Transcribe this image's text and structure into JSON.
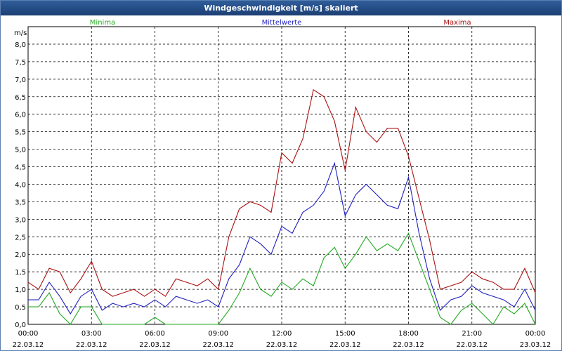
{
  "window": {
    "title": "Windgeschwindigkeit [m/s] skaliert"
  },
  "chart_data": {
    "type": "line",
    "title": "Windgeschwindigkeit [m/s] skaliert",
    "ylabel": "m/s",
    "ylim": [
      0,
      8.5
    ],
    "grid": true,
    "legend_placement": "top",
    "y_ticks": [
      "0,0",
      "0,5",
      "1,0",
      "1,5",
      "2,0",
      "2,5",
      "3,0",
      "3,5",
      "4,0",
      "4,5",
      "5,0",
      "5,5",
      "6,0",
      "6,5",
      "7,0",
      "7,5",
      "8,0"
    ],
    "x_ticks": [
      {
        "time": "00:00",
        "date": "22.03.12"
      },
      {
        "time": "03:00",
        "date": "22.03.12"
      },
      {
        "time": "06:00",
        "date": "22.03.12"
      },
      {
        "time": "09:00",
        "date": "22.03.12"
      },
      {
        "time": "12:00",
        "date": "22.03.12"
      },
      {
        "time": "15:00",
        "date": "22.03.12"
      },
      {
        "time": "18:00",
        "date": "22.03.12"
      },
      {
        "time": "21:00",
        "date": "22.03.12"
      },
      {
        "time": "00:00",
        "date": "23.03.12"
      }
    ],
    "x_hours": [
      0,
      0.5,
      1,
      1.5,
      2,
      2.5,
      3,
      3.5,
      4,
      4.5,
      5,
      5.5,
      6,
      6.5,
      7,
      7.5,
      8,
      8.5,
      9,
      9.5,
      10,
      10.5,
      11,
      11.5,
      12,
      12.5,
      13,
      13.5,
      14,
      14.5,
      15,
      15.5,
      16,
      16.5,
      17,
      17.5,
      18,
      18.5,
      19,
      19.5,
      20,
      20.5,
      21,
      21.5,
      22,
      22.5,
      23,
      23.5,
      24
    ],
    "series": [
      {
        "name": "Minima",
        "color": "#22aa22",
        "values": [
          0.5,
          0.5,
          0.9,
          0.3,
          0.0,
          0.5,
          0.5,
          0.0,
          0.0,
          0.0,
          0.0,
          0.0,
          0.2,
          0.0,
          0.0,
          0.0,
          0.0,
          0.0,
          0.0,
          0.4,
          0.9,
          1.6,
          1.0,
          0.8,
          1.2,
          1.0,
          1.3,
          1.1,
          1.9,
          2.2,
          1.6,
          2.0,
          2.5,
          2.1,
          2.3,
          2.1,
          2.6,
          1.8,
          1.0,
          0.2,
          0.0,
          0.4,
          0.6,
          0.3,
          0.0,
          0.5,
          0.3,
          0.6,
          0.0
        ]
      },
      {
        "name": "Mittelwerte",
        "color": "#1f1fbf",
        "values": [
          0.7,
          0.7,
          1.2,
          0.8,
          0.3,
          0.8,
          1.0,
          0.4,
          0.6,
          0.5,
          0.6,
          0.5,
          0.7,
          0.5,
          0.8,
          0.7,
          0.6,
          0.7,
          0.5,
          1.3,
          1.7,
          2.5,
          2.3,
          2.0,
          2.8,
          2.6,
          3.2,
          3.4,
          3.8,
          4.6,
          3.1,
          3.7,
          4.0,
          3.7,
          3.4,
          3.3,
          4.2,
          2.6,
          1.3,
          0.4,
          0.7,
          0.8,
          1.1,
          0.9,
          0.8,
          0.7,
          0.5,
          1.0,
          0.4
        ]
      },
      {
        "name": "Maxima",
        "color": "#aa1111",
        "values": [
          1.2,
          1.0,
          1.6,
          1.5,
          0.9,
          1.3,
          1.8,
          1.0,
          0.8,
          0.9,
          1.0,
          0.8,
          1.0,
          0.8,
          1.3,
          1.2,
          1.1,
          1.3,
          1.0,
          2.5,
          3.3,
          3.5,
          3.4,
          3.2,
          4.9,
          4.6,
          5.3,
          6.7,
          6.5,
          5.8,
          4.4,
          6.2,
          5.5,
          5.2,
          5.6,
          5.6,
          4.8,
          3.6,
          2.4,
          1.0,
          1.1,
          1.2,
          1.5,
          1.3,
          1.2,
          1.0,
          1.0,
          1.6,
          0.9
        ]
      }
    ]
  }
}
